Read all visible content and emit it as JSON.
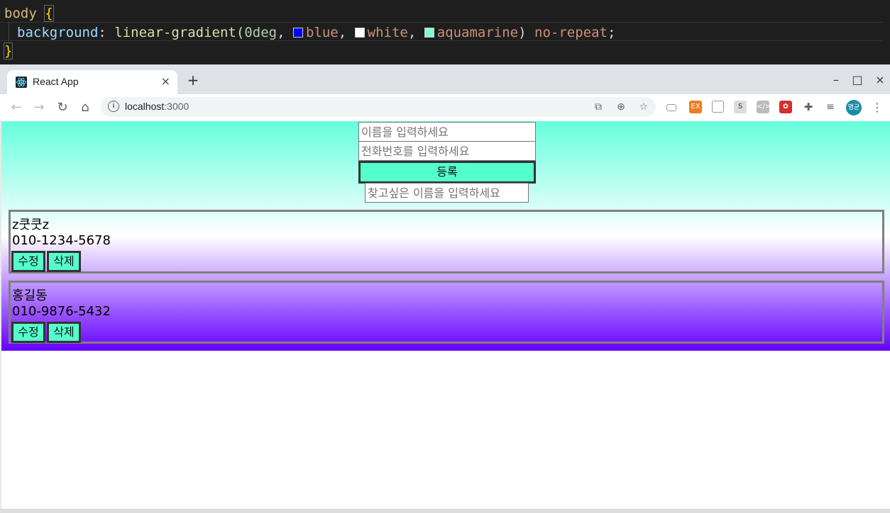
{
  "editor": {
    "selector": "body",
    "open_brace": "{",
    "property": "background",
    "fn_name": "linear-gradient",
    "angle": "0deg",
    "color1": "blue",
    "color2": "white",
    "color3": "aquamarine",
    "tail": "no-repeat",
    "close_brace": "}",
    "swatch_colors": [
      "#0000ff",
      "#ffffff",
      "#7fffd4"
    ]
  },
  "browser": {
    "tab_title": "React App",
    "tab_close": "×",
    "new_tab": "+",
    "url_host": "localhost",
    "url_port": ":3000",
    "profile_label": "명균",
    "window_controls": [
      "–",
      "□",
      "×"
    ],
    "extension_icons": [
      "translate-icon",
      "zoom-icon",
      "star-icon",
      "cast-icon",
      "ex-extension-icon",
      "window-icon",
      "s-extension-icon",
      "code-extension-icon",
      "red-extension-icon",
      "puzzle-icon",
      "reading-list-icon"
    ]
  },
  "app": {
    "name_placeholder": "이름을 입력하세요",
    "phone_placeholder": "전화번호를 입력하세요",
    "register_label": "등록",
    "search_placeholder": "찾고싶은 이름을 입력하세요",
    "contacts": [
      {
        "name": "z쿳쿳z",
        "phone": "010-1234-5678",
        "edit_label": "수정",
        "delete_label": "삭제"
      },
      {
        "name": "홍길동",
        "phone": "010-9876-5432",
        "edit_label": "수정",
        "delete_label": "삭제"
      }
    ],
    "colors": {
      "button_bg": "#55ffcc",
      "gradient_top": "#66ffdd",
      "gradient_bottom": "#6600ff"
    }
  }
}
